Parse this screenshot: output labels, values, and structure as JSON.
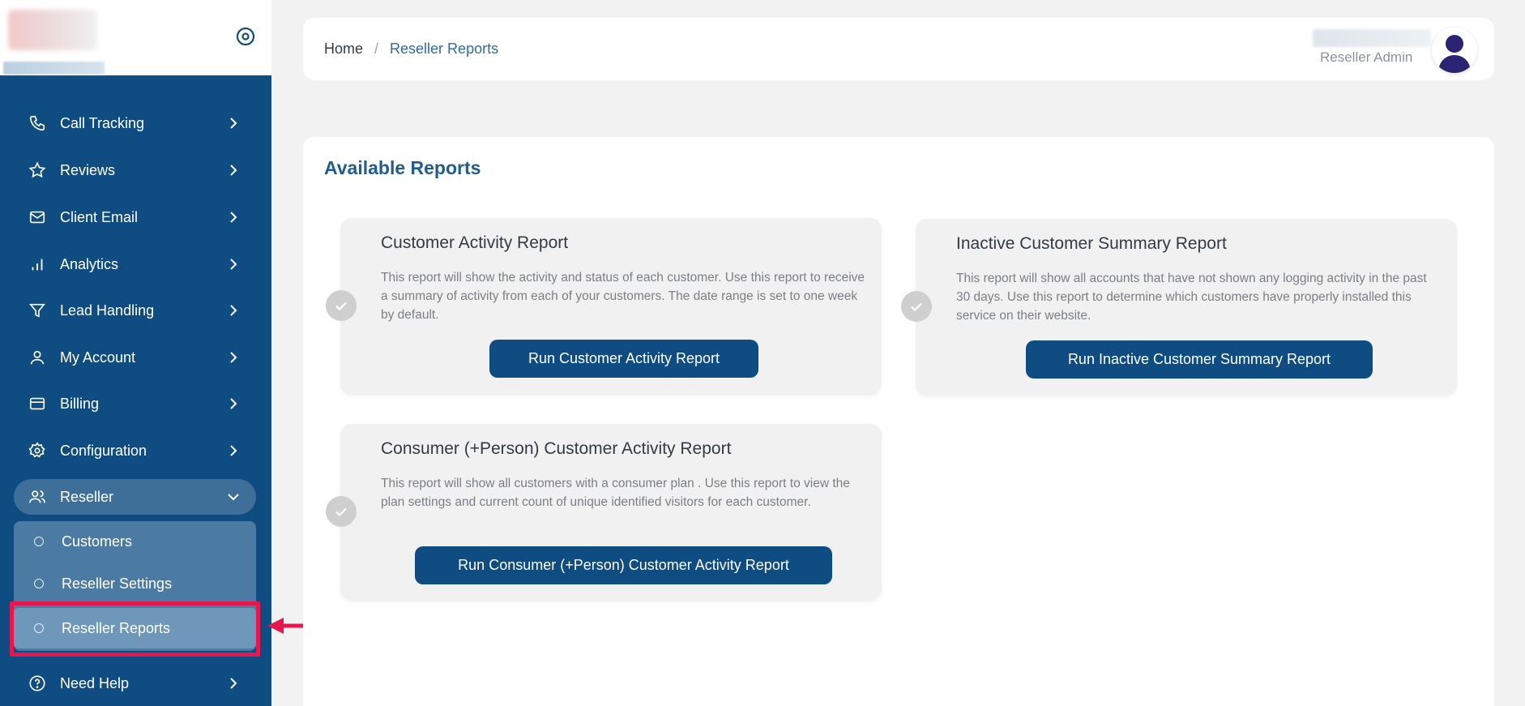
{
  "sidebar": {
    "items": [
      {
        "label": "Call Tracking",
        "icon": "phone-icon"
      },
      {
        "label": "Reviews",
        "icon": "star-icon"
      },
      {
        "label": "Client Email",
        "icon": "mail-icon"
      },
      {
        "label": "Analytics",
        "icon": "bar-chart-icon"
      },
      {
        "label": "Lead Handling",
        "icon": "filter-icon"
      },
      {
        "label": "My Account",
        "icon": "user-icon"
      },
      {
        "label": "Billing",
        "icon": "credit-card-icon"
      },
      {
        "label": "Configuration",
        "icon": "gear-icon"
      },
      {
        "label": "Reseller",
        "icon": "users-icon"
      },
      {
        "label": "Need Help",
        "icon": "help-circle-icon"
      }
    ],
    "reseller_submenu": [
      {
        "label": "Customers"
      },
      {
        "label": "Reseller Settings"
      },
      {
        "label": "Reseller Reports"
      }
    ]
  },
  "header": {
    "breadcrumb": {
      "home": "Home",
      "separator": "/",
      "current": "Reseller Reports"
    },
    "user_role": "Reseller Admin"
  },
  "main": {
    "title": "Available Reports",
    "reports": [
      {
        "title": "Customer Activity Report",
        "description": "This report will show the activity and status of each customer. Use this report to receive a summary of activity from each of your customers. The date range is set to one week by default.",
        "button": "Run Customer Activity Report"
      },
      {
        "title": "Inactive Customer Summary Report",
        "description": "This report will show all accounts that have not shown any logging activity in the past 30 days. Use this report to determine which customers have properly installed this service on their website.",
        "button": "Run Inactive Customer Summary Report"
      },
      {
        "title": "Consumer (+Person) Customer Activity Report",
        "description": "This report will show all customers with a consumer plan . Use this report to view the plan settings and current count of unique identified visitors for each customer.",
        "button": "Run Consumer (+Person) Customer Activity Report"
      }
    ]
  },
  "colors": {
    "sidebar_bg": "#0f4c81",
    "accent": "#1f5d8e",
    "button": "#0f4c81",
    "highlight": "#e8164f"
  }
}
